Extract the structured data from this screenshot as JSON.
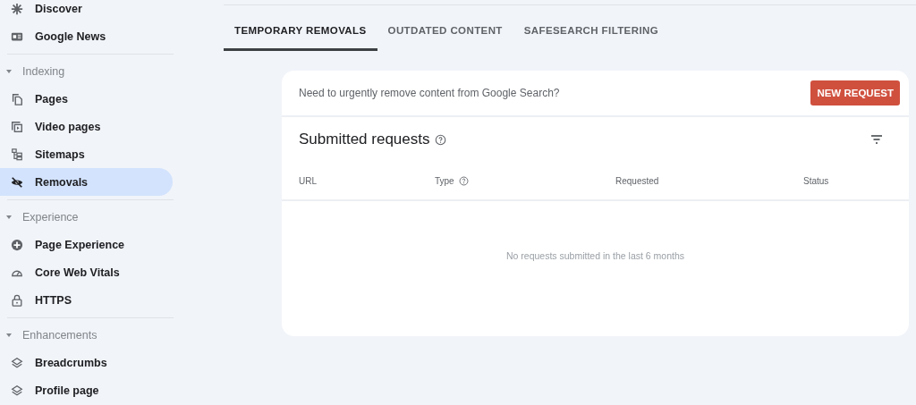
{
  "sidebar": {
    "groups": [
      {
        "items": [
          {
            "label": "Discover",
            "selected": false
          },
          {
            "label": "Google News",
            "selected": false
          }
        ]
      },
      {
        "header": {
          "label": "Indexing",
          "expanded": true
        },
        "items": [
          {
            "label": "Pages",
            "selected": false
          },
          {
            "label": "Video pages",
            "selected": false
          },
          {
            "label": "Sitemaps",
            "selected": false
          },
          {
            "label": "Removals",
            "selected": true
          }
        ]
      },
      {
        "header": {
          "label": "Experience",
          "expanded": true
        },
        "items": [
          {
            "label": "Page Experience",
            "selected": false
          },
          {
            "label": "Core Web Vitals",
            "selected": false
          },
          {
            "label": "HTTPS",
            "selected": false
          }
        ]
      },
      {
        "header": {
          "label": "Enhancements",
          "expanded": true
        },
        "items": [
          {
            "label": "Breadcrumbs",
            "selected": false
          },
          {
            "label": "Profile page",
            "selected": false
          }
        ]
      }
    ]
  },
  "tabs": [
    {
      "label": "TEMPORARY REMOVALS",
      "selected": true
    },
    {
      "label": "OUTDATED CONTENT",
      "selected": false
    },
    {
      "label": "SAFESEARCH FILTERING",
      "selected": false
    }
  ],
  "card": {
    "prompt": "Need to urgently remove content from Google Search?",
    "button": "NEW REQUEST",
    "title": "Submitted requests",
    "table": {
      "columns": [
        "URL",
        "Type",
        "Requested",
        "Status"
      ],
      "empty_message": "No requests submitted in the last 6 months"
    }
  }
}
